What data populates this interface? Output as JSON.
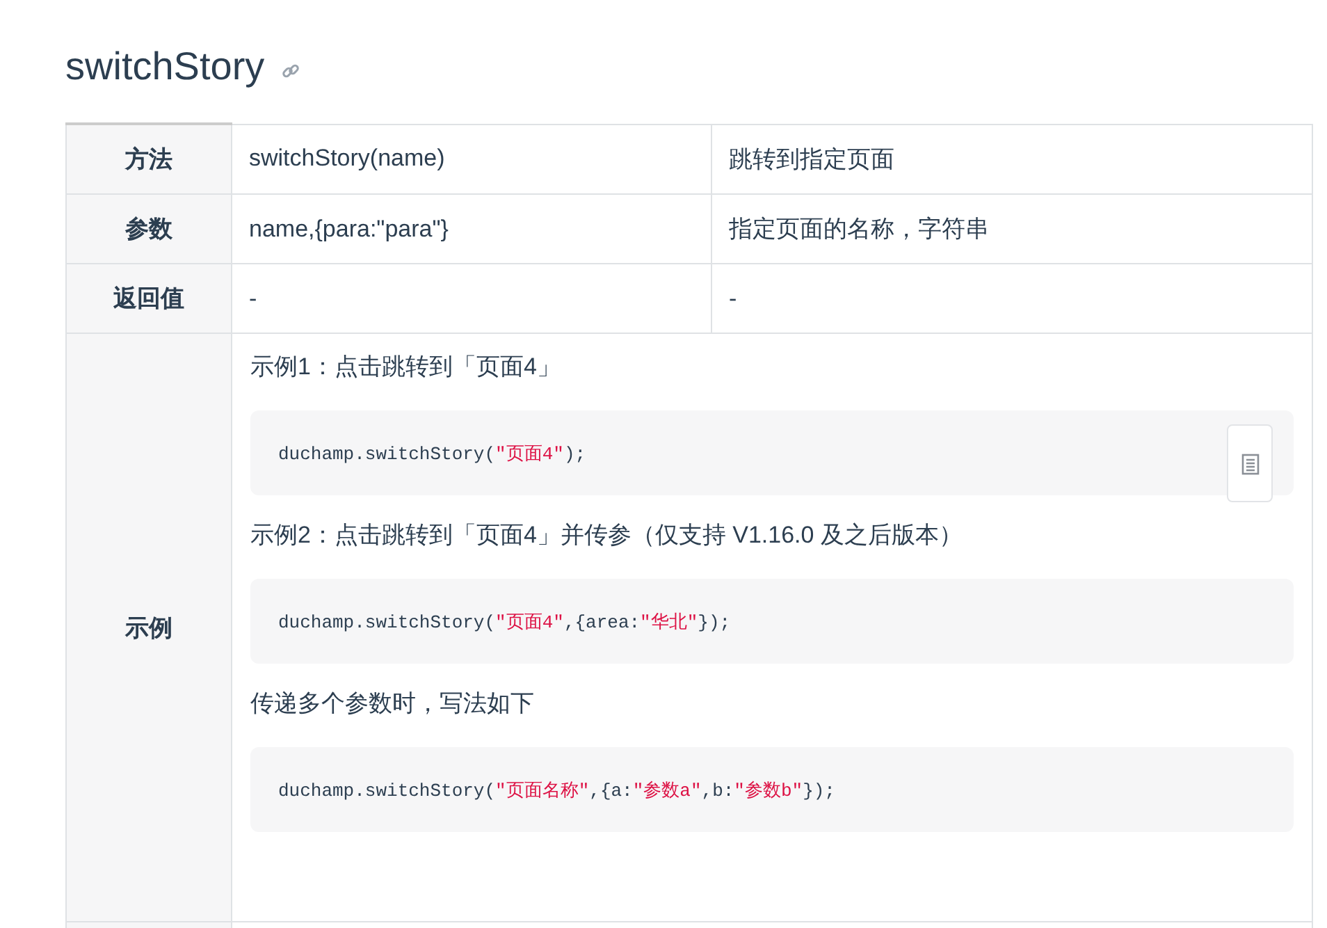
{
  "heading": {
    "title": "switchStory"
  },
  "table": {
    "rows": [
      {
        "label": "方法",
        "cells": [
          "switchStory(name)",
          "跳转到指定页面"
        ]
      },
      {
        "label": "参数",
        "cells": [
          "name,{para:\"para\"}",
          "指定页面的名称，字符串"
        ]
      },
      {
        "label": "返回值",
        "cells": [
          "-",
          "-"
        ]
      }
    ],
    "example": {
      "label": "示例",
      "blocks": [
        {
          "kind": "text",
          "text": "示例1：点击跳转到「页面4」"
        },
        {
          "kind": "code",
          "copy": true,
          "tokens": [
            {
              "kind": "plain",
              "text": "duchamp.switchStory("
            },
            {
              "kind": "string",
              "text": "\"页面4\""
            },
            {
              "kind": "plain",
              "text": ");"
            }
          ]
        },
        {
          "kind": "text",
          "text": "示例2：点击跳转到「页面4」并传参（仅支持 V1.16.0 及之后版本）"
        },
        {
          "kind": "code",
          "copy": false,
          "tokens": [
            {
              "kind": "plain",
              "text": "duchamp.switchStory("
            },
            {
              "kind": "string",
              "text": "\"页面4\""
            },
            {
              "kind": "plain",
              "text": ",{area:"
            },
            {
              "kind": "string",
              "text": "\"华北\""
            },
            {
              "kind": "plain",
              "text": "});"
            }
          ]
        },
        {
          "kind": "text",
          "text": "传递多个参数时，写法如下"
        },
        {
          "kind": "code",
          "copy": false,
          "tokens": [
            {
              "kind": "plain",
              "text": "duchamp.switchStory("
            },
            {
              "kind": "string",
              "text": "\"页面名称\""
            },
            {
              "kind": "plain",
              "text": ",{a:"
            },
            {
              "kind": "string",
              "text": "\"参数a\""
            },
            {
              "kind": "plain",
              "text": ",b:"
            },
            {
              "kind": "string",
              "text": "\"参数b\""
            },
            {
              "kind": "plain",
              "text": "});"
            }
          ]
        }
      ]
    }
  }
}
